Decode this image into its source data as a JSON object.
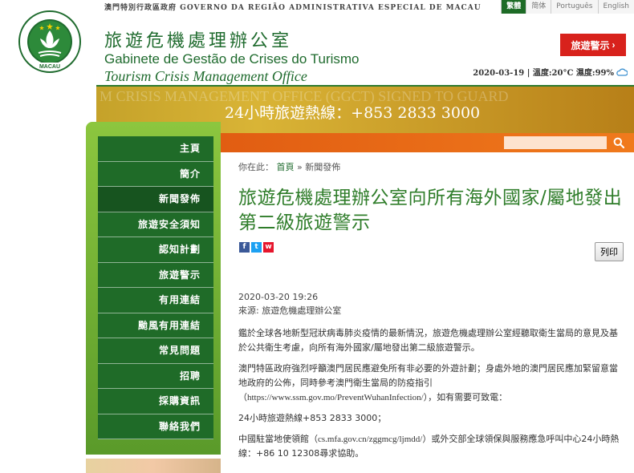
{
  "header": {
    "gov_name": "澳門特別行政區政府 GOVERNO DA REGIÃO ADMINISTRATIVA ESPECIAL DE MACAU",
    "languages": [
      "繁體",
      "简体",
      "Português",
      "English"
    ],
    "active_language": "繁體",
    "emblem_text": "MACAU",
    "title_zh": "旅遊危機處理辦公室",
    "title_pt": "Gabinete de Gestão de Crises do Turismo",
    "title_en": "Tourism Crisis Management Office",
    "alert_button": "旅遊警示",
    "alert_arrow": "›",
    "weather": "2020-03-19 | 溫度:20°C 濕度:99%"
  },
  "banner": {
    "watermark": "M CRISIS MANAGEMENT OFFICE (GGCT) SIGNED TO GUARD",
    "hotline": "24小時旅遊熱線：+853 2833 3000"
  },
  "sidebar": {
    "items": [
      {
        "label": "主頁",
        "active": false
      },
      {
        "label": "簡介",
        "active": false
      },
      {
        "label": "新聞發佈",
        "active": true
      },
      {
        "label": "旅遊安全須知",
        "active": false
      },
      {
        "label": "認知計劃",
        "active": false
      },
      {
        "label": "旅遊警示",
        "active": false
      },
      {
        "label": "有用連結",
        "active": false
      },
      {
        "label": "颱風有用連結",
        "active": false
      },
      {
        "label": "常見問題",
        "active": false
      },
      {
        "label": "招聘",
        "active": false
      },
      {
        "label": "採購資訊",
        "active": false
      },
      {
        "label": "聯絡我們",
        "active": false
      }
    ]
  },
  "search": {
    "placeholder": "",
    "icon": "search-icon"
  },
  "breadcrumb": {
    "prefix": "你在此：",
    "home": "首頁",
    "sep": "»",
    "current": "新聞發佈"
  },
  "article": {
    "title": "旅遊危機處理辦公室向所有海外國家/屬地發出第二級旅遊警示",
    "print_label": "列印",
    "share": [
      "f",
      "t",
      "w"
    ],
    "date": "2020-03-20 19:26",
    "source": "來源: 旅遊危機處理辦公室",
    "p1": "鑑於全球各地新型冠狀病毒肺炎疫情的最新情況，旅遊危機處理辦公室經聽取衛生當局的意見及基於公共衛生考慮，向所有海外國家/屬地發出第二級旅遊警示。",
    "p2a": "澳門特區政府強烈呼籲澳門居民應避免所有非必要的外遊計劃；身處外地的澳門居民應加緊留意當地政府的公佈，同時參考澳門衛生當局的防疫指引（",
    "p2_url": "https://www.ssm.gov.mo/PreventWuhanInfection/",
    "p2b": "），如有需要可致電：",
    "p3": "24小時旅遊熱線+853 2833 3000；",
    "p4a": "中國駐當地使領館（",
    "p4_url": "cs.mfa.gov.cn/zggmcg/ljmdd/",
    "p4b": "）或外交部全球領保與服務應急呼叫中心24小時熱線：+86 10 12308尋求協助。"
  },
  "colors": {
    "green": "#1f6b28",
    "orange": "#f07a1c",
    "red": "#d8221c",
    "gold": "#d9b436"
  }
}
